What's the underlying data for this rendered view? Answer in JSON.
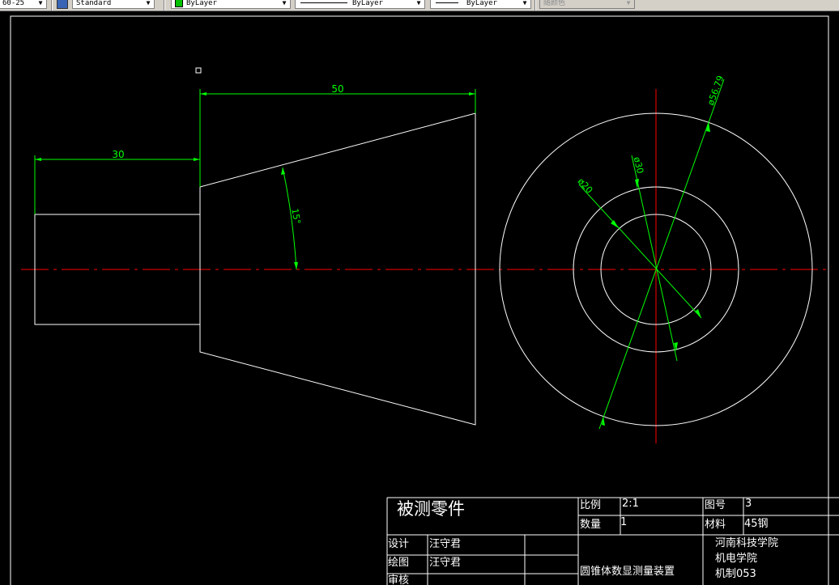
{
  "toolbar": {
    "dimstyle": "60-25",
    "tablestyle": "Standard",
    "layer_color": "ByLayer",
    "linetype": "ByLayer",
    "lineweight": "ByLayer",
    "plotstyle": "随颜色"
  },
  "colors": {
    "background": "#000000",
    "geometry": "#ffffff",
    "dimension": "#00ff00",
    "centerline": "#ff0000",
    "layer_swatch": "#00c000"
  },
  "dimensions": {
    "len_30": "30",
    "len_50": "50",
    "angle": "15°",
    "dia_20": "ø20",
    "dia_30": "ø30",
    "dia_56": "ø56.79"
  },
  "title_block": {
    "part_name": "被测零件",
    "scale_label": "比例",
    "scale_value": "2:1",
    "drawing_no_label": "图号",
    "drawing_no_value": "3",
    "qty_label": "数量",
    "qty_value": "1",
    "material_label": "材料",
    "material_value": "45钢",
    "design_label": "设计",
    "design_value": "汪守君",
    "draw_label": "绘图",
    "draw_value": "汪守君",
    "review_label": "审核",
    "assembly_name": "圆锥体数显测量装置",
    "school": "河南科技学院",
    "college": "机电学院",
    "class": "机制053"
  }
}
